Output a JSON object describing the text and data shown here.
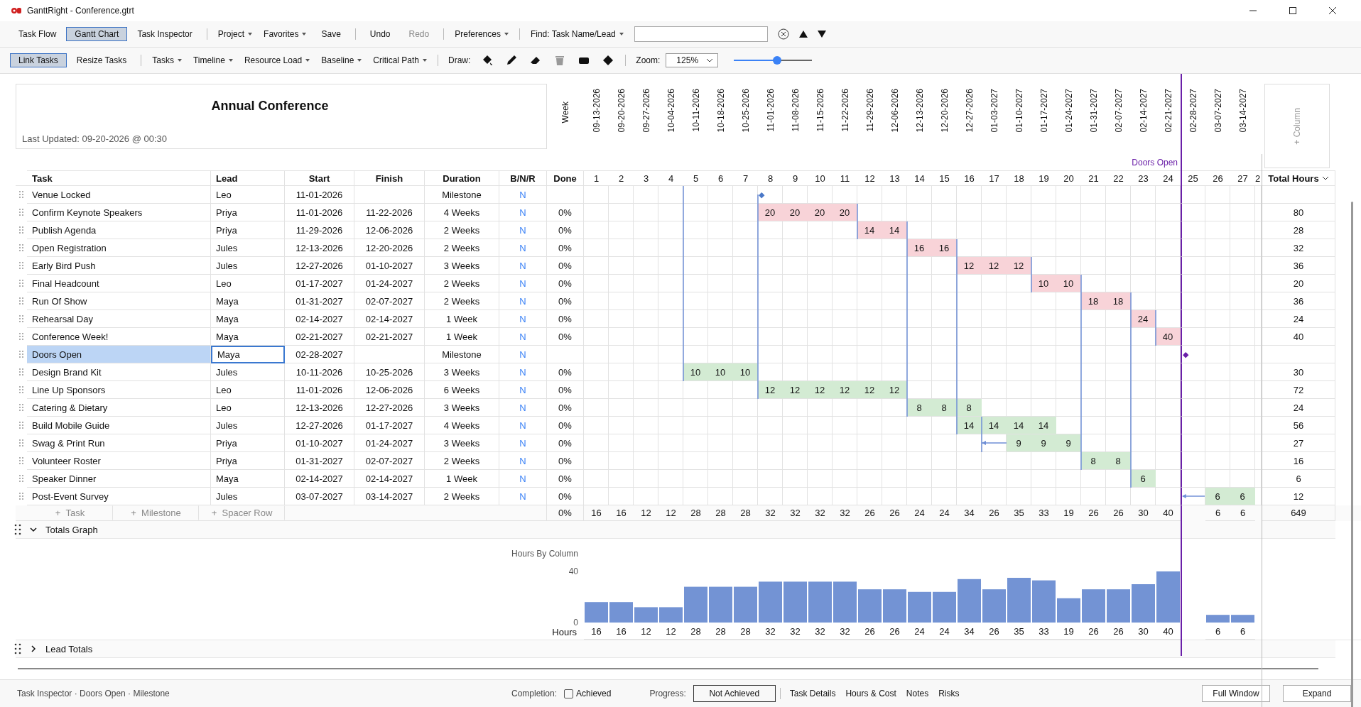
{
  "window": {
    "title": "GanttRight - Conference.gtrt"
  },
  "toolbar": [
    {
      "kind": "tab",
      "label": "Task Flow",
      "selected": false
    },
    {
      "kind": "tab",
      "label": "Gantt Chart",
      "selected": true
    },
    {
      "kind": "tab",
      "label": "Task Inspector",
      "selected": false
    },
    {
      "kind": "separator"
    },
    {
      "kind": "menu",
      "label": "Project"
    },
    {
      "kind": "menu",
      "label": "Favorites"
    },
    {
      "kind": "button",
      "label": "Save",
      "disabled": false
    },
    {
      "kind": "separator"
    },
    {
      "kind": "button",
      "label": "Undo",
      "disabled": false
    },
    {
      "kind": "button",
      "label": "Redo",
      "disabled": true
    },
    {
      "kind": "separator"
    },
    {
      "kind": "menu",
      "label": "Preferences"
    },
    {
      "kind": "separator"
    },
    {
      "kind": "menu",
      "label": "Find: Task Name/Lead"
    },
    {
      "kind": "field"
    },
    {
      "kind": "clear"
    },
    {
      "kind": "up"
    },
    {
      "kind": "down"
    }
  ],
  "chart_toolbar": [
    {
      "kind": "tab",
      "label": "Link Tasks",
      "selected": true
    },
    {
      "kind": "tab",
      "label": "Resize Tasks",
      "selected": false
    },
    {
      "kind": "separator"
    },
    {
      "kind": "menu",
      "label": "Tasks"
    },
    {
      "kind": "menu",
      "label": "Timeline"
    },
    {
      "kind": "menu",
      "label": "Resource Load"
    },
    {
      "kind": "menu",
      "label": "Baseline"
    },
    {
      "kind": "menu",
      "label": "Critical Path"
    },
    {
      "kind": "separator"
    },
    {
      "kind": "label",
      "label": "Draw:"
    },
    {
      "kind": "bucket",
      "disabled": false
    },
    {
      "kind": "pencil",
      "disabled": false
    },
    {
      "kind": "eraser",
      "disabled": false
    },
    {
      "kind": "trash",
      "disabled": true
    },
    {
      "kind": "rectangle",
      "disabled": false
    },
    {
      "kind": "diamond",
      "disabled": false
    },
    {
      "kind": "separator"
    },
    {
      "kind": "label",
      "label": "Zoom:"
    },
    {
      "kind": "select",
      "value": "125%"
    },
    {
      "kind": "slider",
      "level": 0.5
    }
  ],
  "project": {
    "title": "Annual Conference",
    "updated": "Last Updated: 09-20-2026 @ 00:30"
  },
  "timeline": {
    "week_label": "Week",
    "dates": [
      "09-13-2026",
      "09-20-2026",
      "09-27-2026",
      "10-04-2026",
      "10-11-2026",
      "10-18-2026",
      "10-25-2026",
      "11-01-2026",
      "11-08-2026",
      "11-15-2026",
      "11-22-2026",
      "11-29-2026",
      "12-06-2026",
      "12-13-2026",
      "12-20-2026",
      "12-27-2026",
      "01-03-2027",
      "01-10-2027",
      "01-17-2027",
      "01-24-2027",
      "01-31-2027",
      "02-07-2027",
      "02-14-2027",
      "02-21-2027",
      "02-28-2027",
      "03-07-2027",
      "03-14-2027"
    ],
    "marker_label": "Doors Open",
    "add_column": "+ Column",
    "weeks": [
      "1",
      "2",
      "3",
      "4",
      "5",
      "6",
      "7",
      "8",
      "9",
      "10",
      "11",
      "12",
      "13",
      "14",
      "15",
      "16",
      "17",
      "18",
      "19",
      "20",
      "21",
      "22",
      "23",
      "24",
      "25",
      "26",
      "27"
    ],
    "cut_week": "2"
  },
  "columns": [
    "Task",
    "Lead",
    "Start",
    "Finish",
    "Duration",
    "B/N/R",
    "Done"
  ],
  "total_column": "Total Hours",
  "tasks": [
    {
      "kind": "milestone",
      "name": "Venue Locked",
      "lead": "Leo",
      "start": "11-01-2026",
      "duration": "Milestone",
      "bnr": "N",
      "selected": false,
      "color": "#4a78c8",
      "weeks": [
        {
          "filled": false
        },
        {
          "filled": false
        },
        {
          "filled": false
        },
        {
          "filled": false
        },
        {
          "filled": false
        },
        {
          "filled": false
        },
        {
          "filled": false
        },
        {
          "filled": true,
          "marker": "◆"
        }
      ]
    },
    {
      "kind": "task",
      "name": "Confirm Keynote Speakers",
      "lead": "Priya",
      "start": "11-01-2026",
      "finish": "11-22-2026",
      "duration": "4 Weeks",
      "bnr": "N",
      "done": "0%",
      "selected": false,
      "color": "#f8d3d8",
      "total": "80",
      "weeks": [
        {
          "filled": false
        },
        {
          "filled": false
        },
        {
          "filled": false
        },
        {
          "filled": false
        },
        {
          "filled": false
        },
        {
          "filled": false
        },
        {
          "filled": false
        },
        {
          "filled": true,
          "hours": "20"
        },
        {
          "filled": true,
          "hours": "20"
        },
        {
          "filled": true,
          "hours": "20"
        },
        {
          "filled": true,
          "hours": "20"
        }
      ]
    },
    {
      "kind": "task",
      "name": "Publish Agenda",
      "lead": "Priya",
      "start": "11-29-2026",
      "finish": "12-06-2026",
      "duration": "2 Weeks",
      "bnr": "N",
      "done": "0%",
      "selected": false,
      "color": "#f8d3d8",
      "total": "28",
      "weeks": [
        {
          "filled": false
        },
        {
          "filled": false
        },
        {
          "filled": false
        },
        {
          "filled": false
        },
        {
          "filled": false
        },
        {
          "filled": false
        },
        {
          "filled": false
        },
        {
          "filled": false
        },
        {
          "filled": false
        },
        {
          "filled": false
        },
        {
          "filled": false
        },
        {
          "filled": true,
          "hours": "14"
        },
        {
          "filled": true,
          "hours": "14"
        }
      ]
    },
    {
      "kind": "task",
      "name": "Open Registration",
      "lead": "Jules",
      "start": "12-13-2026",
      "finish": "12-20-2026",
      "duration": "2 Weeks",
      "bnr": "N",
      "done": "0%",
      "selected": false,
      "color": "#f8d3d8",
      "total": "32",
      "weeks": [
        {
          "filled": false
        },
        {
          "filled": false
        },
        {
          "filled": false
        },
        {
          "filled": false
        },
        {
          "filled": false
        },
        {
          "filled": false
        },
        {
          "filled": false
        },
        {
          "filled": false
        },
        {
          "filled": false
        },
        {
          "filled": false
        },
        {
          "filled": false
        },
        {
          "filled": false
        },
        {
          "filled": false
        },
        {
          "filled": true,
          "hours": "16"
        },
        {
          "filled": true,
          "hours": "16"
        }
      ]
    },
    {
      "kind": "task",
      "name": "Early Bird Push",
      "lead": "Jules",
      "start": "12-27-2026",
      "finish": "01-10-2027",
      "duration": "3 Weeks",
      "bnr": "N",
      "done": "0%",
      "selected": false,
      "color": "#f8d3d8",
      "total": "36",
      "weeks": [
        {
          "filled": false
        },
        {
          "filled": false
        },
        {
          "filled": false
        },
        {
          "filled": false
        },
        {
          "filled": false
        },
        {
          "filled": false
        },
        {
          "filled": false
        },
        {
          "filled": false
        },
        {
          "filled": false
        },
        {
          "filled": false
        },
        {
          "filled": false
        },
        {
          "filled": false
        },
        {
          "filled": false
        },
        {
          "filled": false
        },
        {
          "filled": false
        },
        {
          "filled": true,
          "hours": "12"
        },
        {
          "filled": true,
          "hours": "12"
        },
        {
          "filled": true,
          "hours": "12"
        }
      ]
    },
    {
      "kind": "task",
      "name": "Final Headcount",
      "lead": "Leo",
      "start": "01-17-2027",
      "finish": "01-24-2027",
      "duration": "2 Weeks",
      "bnr": "N",
      "done": "0%",
      "selected": false,
      "color": "#f8d3d8",
      "total": "20",
      "weeks": [
        {
          "filled": false
        },
        {
          "filled": false
        },
        {
          "filled": false
        },
        {
          "filled": false
        },
        {
          "filled": false
        },
        {
          "filled": false
        },
        {
          "filled": false
        },
        {
          "filled": false
        },
        {
          "filled": false
        },
        {
          "filled": false
        },
        {
          "filled": false
        },
        {
          "filled": false
        },
        {
          "filled": false
        },
        {
          "filled": false
        },
        {
          "filled": false
        },
        {
          "filled": false
        },
        {
          "filled": false
        },
        {
          "filled": false
        },
        {
          "filled": true,
          "hours": "10"
        },
        {
          "filled": true,
          "hours": "10"
        }
      ]
    },
    {
      "kind": "task",
      "name": "Run Of Show",
      "lead": "Maya",
      "start": "01-31-2027",
      "finish": "02-07-2027",
      "duration": "2 Weeks",
      "bnr": "N",
      "done": "0%",
      "selected": false,
      "color": "#f8d3d8",
      "total": "36",
      "weeks": [
        {
          "filled": false
        },
        {
          "filled": false
        },
        {
          "filled": false
        },
        {
          "filled": false
        },
        {
          "filled": false
        },
        {
          "filled": false
        },
        {
          "filled": false
        },
        {
          "filled": false
        },
        {
          "filled": false
        },
        {
          "filled": false
        },
        {
          "filled": false
        },
        {
          "filled": false
        },
        {
          "filled": false
        },
        {
          "filled": false
        },
        {
          "filled": false
        },
        {
          "filled": false
        },
        {
          "filled": false
        },
        {
          "filled": false
        },
        {
          "filled": false
        },
        {
          "filled": false
        },
        {
          "filled": true,
          "hours": "18"
        },
        {
          "filled": true,
          "hours": "18"
        }
      ]
    },
    {
      "kind": "task",
      "name": "Rehearsal Day",
      "lead": "Maya",
      "start": "02-14-2027",
      "finish": "02-14-2027",
      "duration": "1 Week",
      "bnr": "N",
      "done": "0%",
      "selected": false,
      "color": "#f8d3d8",
      "total": "24",
      "weeks": [
        {
          "filled": false
        },
        {
          "filled": false
        },
        {
          "filled": false
        },
        {
          "filled": false
        },
        {
          "filled": false
        },
        {
          "filled": false
        },
        {
          "filled": false
        },
        {
          "filled": false
        },
        {
          "filled": false
        },
        {
          "filled": false
        },
        {
          "filled": false
        },
        {
          "filled": false
        },
        {
          "filled": false
        },
        {
          "filled": false
        },
        {
          "filled": false
        },
        {
          "filled": false
        },
        {
          "filled": false
        },
        {
          "filled": false
        },
        {
          "filled": false
        },
        {
          "filled": false
        },
        {
          "filled": false
        },
        {
          "filled": false
        },
        {
          "filled": true,
          "hours": "24"
        }
      ]
    },
    {
      "kind": "task",
      "name": "Conference Week!",
      "lead": "Maya",
      "start": "02-21-2027",
      "finish": "02-21-2027",
      "duration": "1 Week",
      "bnr": "N",
      "done": "0%",
      "selected": false,
      "color": "#f8d3d8",
      "total": "40",
      "weeks": [
        {
          "filled": false
        },
        {
          "filled": false
        },
        {
          "filled": false
        },
        {
          "filled": false
        },
        {
          "filled": false
        },
        {
          "filled": false
        },
        {
          "filled": false
        },
        {
          "filled": false
        },
        {
          "filled": false
        },
        {
          "filled": false
        },
        {
          "filled": false
        },
        {
          "filled": false
        },
        {
          "filled": false
        },
        {
          "filled": false
        },
        {
          "filled": false
        },
        {
          "filled": false
        },
        {
          "filled": false
        },
        {
          "filled": false
        },
        {
          "filled": false
        },
        {
          "filled": false
        },
        {
          "filled": false
        },
        {
          "filled": false
        },
        {
          "filled": false
        },
        {
          "filled": true,
          "hours": "40"
        }
      ]
    },
    {
      "kind": "milestone",
      "name": "Doors Open",
      "lead": "Maya",
      "start": "02-28-2027",
      "duration": "Milestone",
      "bnr": "N",
      "selected": true,
      "color": "#6a1fa8",
      "weeks": [
        {
          "filled": false
        },
        {
          "filled": false
        },
        {
          "filled": false
        },
        {
          "filled": false
        },
        {
          "filled": false
        },
        {
          "filled": false
        },
        {
          "filled": false
        },
        {
          "filled": false
        },
        {
          "filled": false
        },
        {
          "filled": false
        },
        {
          "filled": false
        },
        {
          "filled": false
        },
        {
          "filled": false
        },
        {
          "filled": false
        },
        {
          "filled": false
        },
        {
          "filled": false
        },
        {
          "filled": false
        },
        {
          "filled": false
        },
        {
          "filled": false
        },
        {
          "filled": false
        },
        {
          "filled": false
        },
        {
          "filled": false
        },
        {
          "filled": false
        },
        {
          "filled": false
        },
        {
          "filled": true,
          "marker": "◆"
        }
      ]
    },
    {
      "kind": "task",
      "name": "Design Brand Kit",
      "lead": "Jules",
      "start": "10-11-2026",
      "finish": "10-25-2026",
      "duration": "3 Weeks",
      "bnr": "N",
      "done": "0%",
      "selected": false,
      "color": "#d3ebd3",
      "total": "30",
      "weeks": [
        {
          "filled": false
        },
        {
          "filled": false
        },
        {
          "filled": false
        },
        {
          "filled": false
        },
        {
          "filled": true,
          "hours": "10"
        },
        {
          "filled": true,
          "hours": "10"
        },
        {
          "filled": true,
          "hours": "10"
        }
      ]
    },
    {
      "kind": "task",
      "name": "Line Up Sponsors",
      "lead": "Leo",
      "start": "11-01-2026",
      "finish": "12-06-2026",
      "duration": "6 Weeks",
      "bnr": "N",
      "done": "0%",
      "selected": false,
      "color": "#d3ebd3",
      "total": "72",
      "weeks": [
        {
          "filled": false
        },
        {
          "filled": false
        },
        {
          "filled": false
        },
        {
          "filled": false
        },
        {
          "filled": false
        },
        {
          "filled": false
        },
        {
          "filled": false
        },
        {
          "filled": true,
          "hours": "12"
        },
        {
          "filled": true,
          "hours": "12"
        },
        {
          "filled": true,
          "hours": "12"
        },
        {
          "filled": true,
          "hours": "12"
        },
        {
          "filled": true,
          "hours": "12"
        },
        {
          "filled": true,
          "hours": "12"
        }
      ]
    },
    {
      "kind": "task",
      "name": "Catering & Dietary",
      "lead": "Leo",
      "start": "12-13-2026",
      "finish": "12-27-2026",
      "duration": "3 Weeks",
      "bnr": "N",
      "done": "0%",
      "selected": false,
      "color": "#d3ebd3",
      "total": "24",
      "weeks": [
        {
          "filled": false
        },
        {
          "filled": false
        },
        {
          "filled": false
        },
        {
          "filled": false
        },
        {
          "filled": false
        },
        {
          "filled": false
        },
        {
          "filled": false
        },
        {
          "filled": false
        },
        {
          "filled": false
        },
        {
          "filled": false
        },
        {
          "filled": false
        },
        {
          "filled": false
        },
        {
          "filled": false
        },
        {
          "filled": true,
          "hours": "8"
        },
        {
          "filled": true,
          "hours": "8"
        },
        {
          "filled": true,
          "hours": "8"
        }
      ]
    },
    {
      "kind": "task",
      "name": "Build Mobile Guide",
      "lead": "Jules",
      "start": "12-27-2026",
      "finish": "01-17-2027",
      "duration": "4 Weeks",
      "bnr": "N",
      "done": "0%",
      "selected": false,
      "color": "#d3ebd3",
      "total": "56",
      "weeks": [
        {
          "filled": false
        },
        {
          "filled": false
        },
        {
          "filled": false
        },
        {
          "filled": false
        },
        {
          "filled": false
        },
        {
          "filled": false
        },
        {
          "filled": false
        },
        {
          "filled": false
        },
        {
          "filled": false
        },
        {
          "filled": false
        },
        {
          "filled": false
        },
        {
          "filled": false
        },
        {
          "filled": false
        },
        {
          "filled": false
        },
        {
          "filled": false
        },
        {
          "filled": true,
          "hours": "14"
        },
        {
          "filled": true,
          "hours": "14"
        },
        {
          "filled": true,
          "hours": "14"
        },
        {
          "filled": true,
          "hours": "14"
        }
      ]
    },
    {
      "kind": "task",
      "name": "Swag & Print Run",
      "lead": "Priya",
      "start": "01-10-2027",
      "finish": "01-24-2027",
      "duration": "3 Weeks",
      "bnr": "N",
      "done": "0%",
      "selected": false,
      "color": "#d3ebd3",
      "total": "27",
      "weeks": [
        {
          "filled": false
        },
        {
          "filled": false
        },
        {
          "filled": false
        },
        {
          "filled": false
        },
        {
          "filled": false
        },
        {
          "filled": false
        },
        {
          "filled": false
        },
        {
          "filled": false
        },
        {
          "filled": false
        },
        {
          "filled": false
        },
        {
          "filled": false
        },
        {
          "filled": false
        },
        {
          "filled": false
        },
        {
          "filled": false
        },
        {
          "filled": false
        },
        {
          "filled": false
        },
        {
          "filled": false
        },
        {
          "filled": true,
          "hours": "9"
        },
        {
          "filled": true,
          "hours": "9"
        },
        {
          "filled": true,
          "hours": "9"
        }
      ]
    },
    {
      "kind": "task",
      "name": "Volunteer Roster",
      "lead": "Priya",
      "start": "01-31-2027",
      "finish": "02-07-2027",
      "duration": "2 Weeks",
      "bnr": "N",
      "done": "0%",
      "selected": false,
      "color": "#d3ebd3",
      "total": "16",
      "weeks": [
        {
          "filled": false
        },
        {
          "filled": false
        },
        {
          "filled": false
        },
        {
          "filled": false
        },
        {
          "filled": false
        },
        {
          "filled": false
        },
        {
          "filled": false
        },
        {
          "filled": false
        },
        {
          "filled": false
        },
        {
          "filled": false
        },
        {
          "filled": false
        },
        {
          "filled": false
        },
        {
          "filled": false
        },
        {
          "filled": false
        },
        {
          "filled": false
        },
        {
          "filled": false
        },
        {
          "filled": false
        },
        {
          "filled": false
        },
        {
          "filled": false
        },
        {
          "filled": false
        },
        {
          "filled": true,
          "hours": "8"
        },
        {
          "filled": true,
          "hours": "8"
        }
      ]
    },
    {
      "kind": "task",
      "name": "Speaker Dinner",
      "lead": "Maya",
      "start": "02-14-2027",
      "finish": "02-14-2027",
      "duration": "1 Week",
      "bnr": "N",
      "done": "0%",
      "selected": false,
      "color": "#d3ebd3",
      "total": "6",
      "weeks": [
        {
          "filled": false
        },
        {
          "filled": false
        },
        {
          "filled": false
        },
        {
          "filled": false
        },
        {
          "filled": false
        },
        {
          "filled": false
        },
        {
          "filled": false
        },
        {
          "filled": false
        },
        {
          "filled": false
        },
        {
          "filled": false
        },
        {
          "filled": false
        },
        {
          "filled": false
        },
        {
          "filled": false
        },
        {
          "filled": false
        },
        {
          "filled": false
        },
        {
          "filled": false
        },
        {
          "filled": false
        },
        {
          "filled": false
        },
        {
          "filled": false
        },
        {
          "filled": false
        },
        {
          "filled": false
        },
        {
          "filled": false
        },
        {
          "filled": true,
          "hours": "6"
        }
      ]
    },
    {
      "kind": "task",
      "name": "Post-Event Survey",
      "lead": "Jules",
      "start": "03-07-2027",
      "finish": "03-14-2027",
      "duration": "2 Weeks",
      "bnr": "N",
      "done": "0%",
      "selected": false,
      "color": "#d3ebd3",
      "total": "12",
      "weeks": [
        {
          "filled": false
        },
        {
          "filled": false
        },
        {
          "filled": false
        },
        {
          "filled": false
        },
        {
          "filled": false
        },
        {
          "filled": false
        },
        {
          "filled": false
        },
        {
          "filled": false
        },
        {
          "filled": false
        },
        {
          "filled": false
        },
        {
          "filled": false
        },
        {
          "filled": false
        },
        {
          "filled": false
        },
        {
          "filled": false
        },
        {
          "filled": false
        },
        {
          "filled": false
        },
        {
          "filled": false
        },
        {
          "filled": false
        },
        {
          "filled": false
        },
        {
          "filled": false
        },
        {
          "filled": false
        },
        {
          "filled": false
        },
        {
          "filled": false
        },
        {
          "filled": false
        },
        {
          "filled": false
        },
        {
          "filled": true,
          "hours": "6"
        },
        {
          "filled": true,
          "hours": "6"
        }
      ]
    }
  ],
  "add_buttons": [
    "+  Task",
    "+  Milestone",
    "+  Spacer Row"
  ],
  "totals": {
    "done": "0%",
    "columns": [
      {
        "shown": true,
        "value": "16"
      },
      {
        "shown": true,
        "value": "16"
      },
      {
        "shown": true,
        "value": "12"
      },
      {
        "shown": true,
        "value": "12"
      },
      {
        "shown": true,
        "value": "28"
      },
      {
        "shown": true,
        "value": "28"
      },
      {
        "shown": true,
        "value": "28"
      },
      {
        "shown": true,
        "value": "32"
      },
      {
        "shown": true,
        "value": "32"
      },
      {
        "shown": true,
        "value": "32"
      },
      {
        "shown": true,
        "value": "32"
      },
      {
        "shown": true,
        "value": "26"
      },
      {
        "shown": true,
        "value": "26"
      },
      {
        "shown": true,
        "value": "24"
      },
      {
        "shown": true,
        "value": "24"
      },
      {
        "shown": true,
        "value": "34"
      },
      {
        "shown": true,
        "value": "26"
      },
      {
        "shown": true,
        "value": "35"
      },
      {
        "shown": true,
        "value": "33"
      },
      {
        "shown": true,
        "value": "19"
      },
      {
        "shown": true,
        "value": "26"
      },
      {
        "shown": true,
        "value": "26"
      },
      {
        "shown": true,
        "value": "30"
      },
      {
        "shown": true,
        "value": "40"
      },
      {
        "shown": false
      },
      {
        "shown": true,
        "value": "6"
      },
      {
        "shown": true,
        "value": "6"
      }
    ],
    "total": "649"
  },
  "sections": [
    {
      "label": "Totals Graph",
      "expanded": true
    },
    {
      "label": "Lead Totals",
      "expanded": false
    }
  ],
  "graph": {
    "chart_data": {
      "type": "bar",
      "title": "Hours By Column",
      "xlabel": "Hours",
      "categories": [
        "16",
        "16",
        "12",
        "12",
        "28",
        "28",
        "28",
        "32",
        "32",
        "32",
        "32",
        "26",
        "26",
        "24",
        "24",
        "34",
        "26",
        "35",
        "33",
        "19",
        "26",
        "26",
        "30",
        "40",
        null,
        "6",
        "6"
      ],
      "values": [
        16,
        16,
        12,
        12,
        28,
        28,
        28,
        32,
        32,
        32,
        32,
        26,
        26,
        24,
        24,
        34,
        26,
        35,
        33,
        19,
        26,
        26,
        30,
        40,
        null,
        6,
        6
      ],
      "yticks": [
        0,
        40
      ],
      "ylim": [
        0,
        40
      ]
    }
  },
  "status_bar": {
    "breadcrumb": "Task Inspector · Doors Open · Milestone",
    "completion_label": "Completion:",
    "achieved": {
      "label": "Achieved",
      "checked": false
    },
    "progress_label": "Progress:",
    "progress": "Not Achieved",
    "tabs": [
      {
        "label": "Task Details",
        "selected": false
      },
      {
        "label": "Hours & Cost",
        "selected": false
      },
      {
        "label": "Notes",
        "selected": false
      },
      {
        "label": "Risks",
        "selected": false
      }
    ],
    "buttons": [
      "Full Window",
      "Expand"
    ]
  }
}
